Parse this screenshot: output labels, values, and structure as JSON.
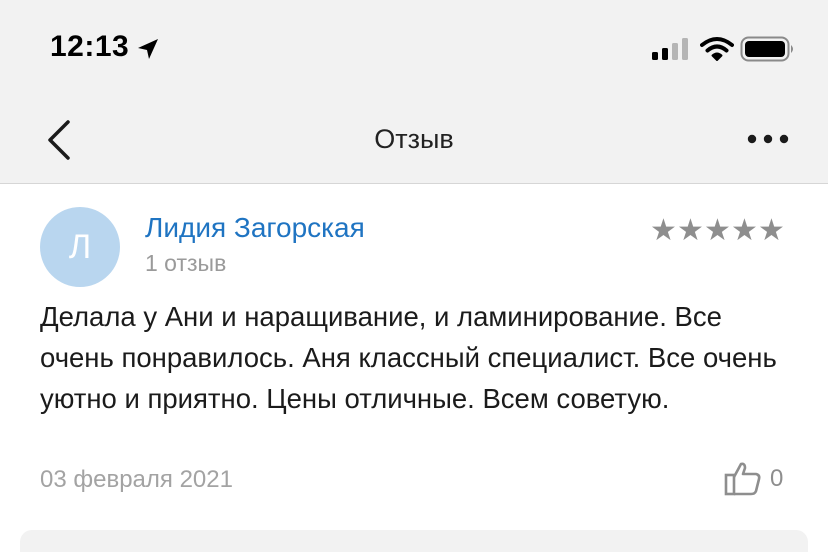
{
  "status_bar": {
    "time": "12:13"
  },
  "header": {
    "title": "Отзыв"
  },
  "review": {
    "avatar_letter": "Л",
    "author_name": "Лидия Загорская",
    "author_reviews": "1 отзыв",
    "rating": 5,
    "stars": "★★★★★",
    "text": "Делала у Ани и наращивание, и ламинирование. Все очень понравилось. Аня классный специалист. Все очень уютно и приятно. Цены отличные. Всем советую.",
    "date": "03 февраля 2021",
    "likes": "0"
  },
  "colors": {
    "link": "#1f74c2",
    "avatar_bg": "#b9d6ef",
    "header_bg": "#f2f2f2",
    "muted": "#9a9a9a"
  },
  "icons": [
    "location-arrow-icon",
    "signal-icon",
    "wifi-icon",
    "battery-icon",
    "chevron-left-icon",
    "more-dots-icon",
    "thumbs-up-icon"
  ]
}
